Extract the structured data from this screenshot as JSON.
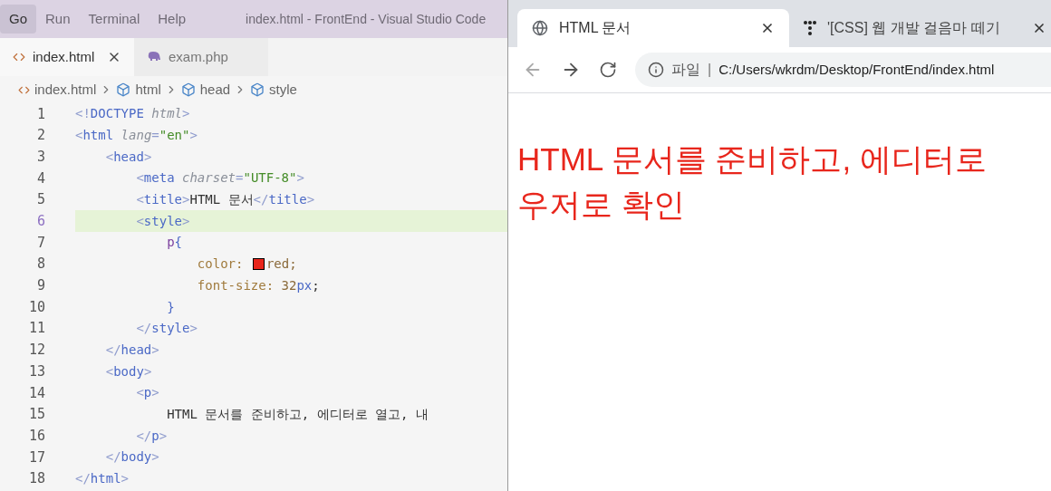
{
  "editor": {
    "menu": [
      {
        "label": "Go",
        "selected": true
      },
      {
        "label": "Run",
        "selected": false
      },
      {
        "label": "Terminal",
        "selected": false
      },
      {
        "label": "Help",
        "selected": false
      }
    ],
    "window_title": "index.html - FrontEnd - Visual Studio Code",
    "tabs": [
      {
        "label": "index.html",
        "selected": true,
        "kind": "html"
      },
      {
        "label": "exam.php",
        "selected": false,
        "kind": "php"
      }
    ],
    "breadcrumbs": [
      {
        "label": "index.html",
        "kind": "file"
      },
      {
        "label": "html",
        "kind": "element"
      },
      {
        "label": "head",
        "kind": "element"
      },
      {
        "label": "style",
        "kind": "element"
      }
    ],
    "lines": [
      {
        "number": "1",
        "selected": false,
        "tokens": [
          {
            "kind": "punct",
            "text": "<!"
          },
          {
            "kind": "tag",
            "text": "DOCTYPE "
          },
          {
            "kind": "attr",
            "text": "html"
          },
          {
            "kind": "punct",
            "text": ">"
          }
        ]
      },
      {
        "number": "2",
        "selected": false,
        "tokens": [
          {
            "kind": "punct",
            "text": "<"
          },
          {
            "kind": "tag",
            "text": "html "
          },
          {
            "kind": "attr",
            "text": "lang"
          },
          {
            "kind": "punct",
            "text": "="
          },
          {
            "kind": "string",
            "text": "\"en\""
          },
          {
            "kind": "punct",
            "text": ">"
          }
        ]
      },
      {
        "number": "3",
        "selected": false,
        "tokens": [
          {
            "kind": "punct",
            "text": "    <"
          },
          {
            "kind": "tag",
            "text": "head"
          },
          {
            "kind": "punct",
            "text": ">"
          }
        ]
      },
      {
        "number": "4",
        "selected": false,
        "tokens": [
          {
            "kind": "punct",
            "text": "        <"
          },
          {
            "kind": "tag",
            "text": "meta "
          },
          {
            "kind": "attr",
            "text": "charset"
          },
          {
            "kind": "punct",
            "text": "="
          },
          {
            "kind": "string",
            "text": "\"UTF-8\""
          },
          {
            "kind": "punct",
            "text": ">"
          }
        ]
      },
      {
        "number": "5",
        "selected": false,
        "tokens": [
          {
            "kind": "punct",
            "text": "        <"
          },
          {
            "kind": "tag",
            "text": "title"
          },
          {
            "kind": "punct",
            "text": ">"
          },
          {
            "kind": "text",
            "text": "HTML 문서"
          },
          {
            "kind": "punct",
            "text": "</"
          },
          {
            "kind": "tag",
            "text": "title"
          },
          {
            "kind": "punct",
            "text": ">"
          }
        ]
      },
      {
        "number": "6",
        "selected": true,
        "tokens": [
          {
            "kind": "punct",
            "text": "        <"
          },
          {
            "kind": "tag",
            "text": "style"
          },
          {
            "kind": "punct",
            "text": ">"
          }
        ]
      },
      {
        "number": "7",
        "selected": false,
        "tokens": [
          {
            "kind": "selector",
            "text": "            p"
          },
          {
            "kind": "brace",
            "text": "{"
          }
        ]
      },
      {
        "number": "8",
        "selected": false,
        "tokens": [
          {
            "kind": "prop",
            "text": "                color: "
          },
          {
            "kind": "swatch",
            "color": "#e8261c"
          },
          {
            "kind": "value",
            "text": "red;"
          }
        ]
      },
      {
        "number": "9",
        "selected": false,
        "tokens": [
          {
            "kind": "prop",
            "text": "                font-size: "
          },
          {
            "kind": "value",
            "text": "32"
          },
          {
            "kind": "unit",
            "text": "px"
          },
          {
            "kind": "text",
            "text": ";"
          }
        ]
      },
      {
        "number": "10",
        "selected": false,
        "tokens": [
          {
            "kind": "brace",
            "text": "            }"
          }
        ]
      },
      {
        "number": "11",
        "selected": false,
        "tokens": [
          {
            "kind": "punct",
            "text": "        </"
          },
          {
            "kind": "tag",
            "text": "style"
          },
          {
            "kind": "punct",
            "text": ">"
          }
        ]
      },
      {
        "number": "12",
        "selected": false,
        "tokens": [
          {
            "kind": "punct",
            "text": "    </"
          },
          {
            "kind": "tag",
            "text": "head"
          },
          {
            "kind": "punct",
            "text": ">"
          }
        ]
      },
      {
        "number": "13",
        "selected": false,
        "tokens": [
          {
            "kind": "punct",
            "text": "    <"
          },
          {
            "kind": "tag",
            "text": "body"
          },
          {
            "kind": "punct",
            "text": ">"
          }
        ]
      },
      {
        "number": "14",
        "selected": false,
        "tokens": [
          {
            "kind": "punct",
            "text": "        <"
          },
          {
            "kind": "tag",
            "text": "p"
          },
          {
            "kind": "punct",
            "text": ">"
          }
        ]
      },
      {
        "number": "15",
        "selected": false,
        "tokens": [
          {
            "kind": "text",
            "text": "            HTML 문서를 준비하고, 에디터로 열고, 내"
          }
        ]
      },
      {
        "number": "16",
        "selected": false,
        "tokens": [
          {
            "kind": "punct",
            "text": "        </"
          },
          {
            "kind": "tag",
            "text": "p"
          },
          {
            "kind": "punct",
            "text": ">"
          }
        ]
      },
      {
        "number": "17",
        "selected": false,
        "tokens": [
          {
            "kind": "punct",
            "text": "    </"
          },
          {
            "kind": "tag",
            "text": "body"
          },
          {
            "kind": "punct",
            "text": ">"
          }
        ]
      },
      {
        "number": "18",
        "selected": false,
        "tokens": [
          {
            "kind": "punct",
            "text": "</"
          },
          {
            "kind": "tag",
            "text": "html"
          },
          {
            "kind": "punct",
            "text": ">"
          }
        ]
      }
    ]
  },
  "browser": {
    "tabs": [
      {
        "title": "HTML 문서",
        "selected": true,
        "kind": "globe"
      },
      {
        "title": "'[CSS] 웹 개발 걸음마 떼기",
        "selected": false,
        "kind": "site"
      }
    ],
    "address": {
      "scheme": "파일",
      "separator": "|",
      "url": "C:/Users/wkrdm/Desktop/FrontEnd/index.html"
    },
    "content": [
      "HTML 문서를 준비하고, 에디터로",
      "우저로 확인"
    ]
  }
}
